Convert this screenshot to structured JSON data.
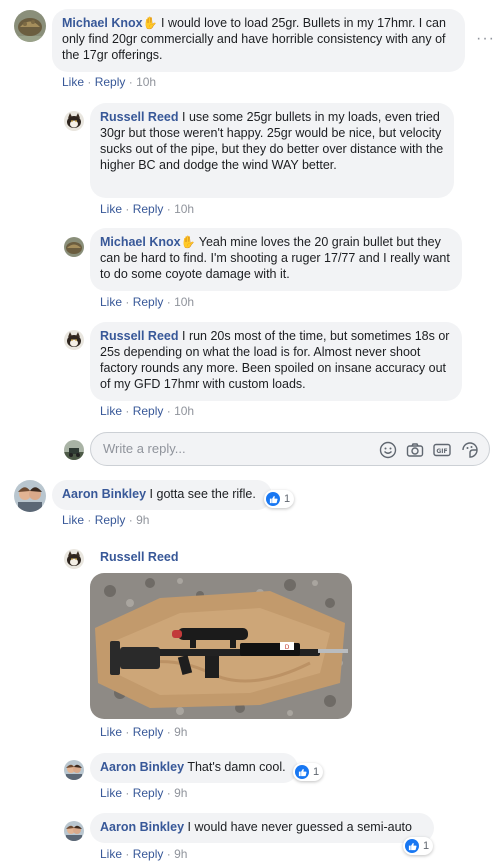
{
  "comment1": {
    "author": "Michael Knox",
    "text": "I would love to load 25gr. Bullets in my 17hmr. I can only find 20gr commercially and have horrible consistency with any of the 17gr offerings.",
    "like": "Like",
    "reply": "Reply",
    "time": "10h",
    "menu_icon": "···"
  },
  "reply1": {
    "author": "Russell Reed",
    "text": "I use some 25gr bullets in my loads, even tried 30gr but those weren't happy. 25gr would be nice, but velocity sucks out of the pipe, but they do better over distance with the higher BC and dodge the wind WAY better.",
    "like": "Like",
    "reply": "Reply",
    "time": "10h"
  },
  "reply2": {
    "author": "Michael Knox",
    "text": "Yeah mine loves the 20 grain bullet but they can be hard to find. I'm shooting a ruger 17/77 and I really want to do some coyote damage with it.",
    "like": "Like",
    "reply": "Reply",
    "time": "10h"
  },
  "reply3": {
    "author": "Russell Reed",
    "text": "I run 20s most of the time, but sometimes 18s or 25s depending on what the load is for. Almost never shoot factory rounds any more. Been spoiled on insane accuracy out of my GFD 17hmr with custom loads.",
    "like": "Like",
    "reply": "Reply",
    "time": "10h"
  },
  "reply_input": {
    "placeholder": "Write a reply..."
  },
  "comment2": {
    "author": "Aaron Binkley",
    "text": "I gotta see the rifle.",
    "like": "Like",
    "reply": "Reply",
    "time": "9h",
    "reaction_count": "1"
  },
  "reply4": {
    "author": "Russell Reed",
    "like": "Like",
    "reply": "Reply",
    "time": "9h"
  },
  "reply5": {
    "author": "Aaron Binkley",
    "text": "That's damn cool.",
    "like": "Like",
    "reply": "Reply",
    "time": "9h",
    "reaction_count": "1"
  },
  "reply6": {
    "author": "Aaron Binkley",
    "text": "I would have never guessed a semi-auto",
    "like": "Like",
    "reply": "Reply",
    "time": "9h",
    "reaction_count": "1"
  },
  "sep": "·",
  "colors": {
    "link": "#385898",
    "bubble": "#f2f3f5",
    "like_blue": "#1877f2",
    "meta": "#90949c"
  }
}
